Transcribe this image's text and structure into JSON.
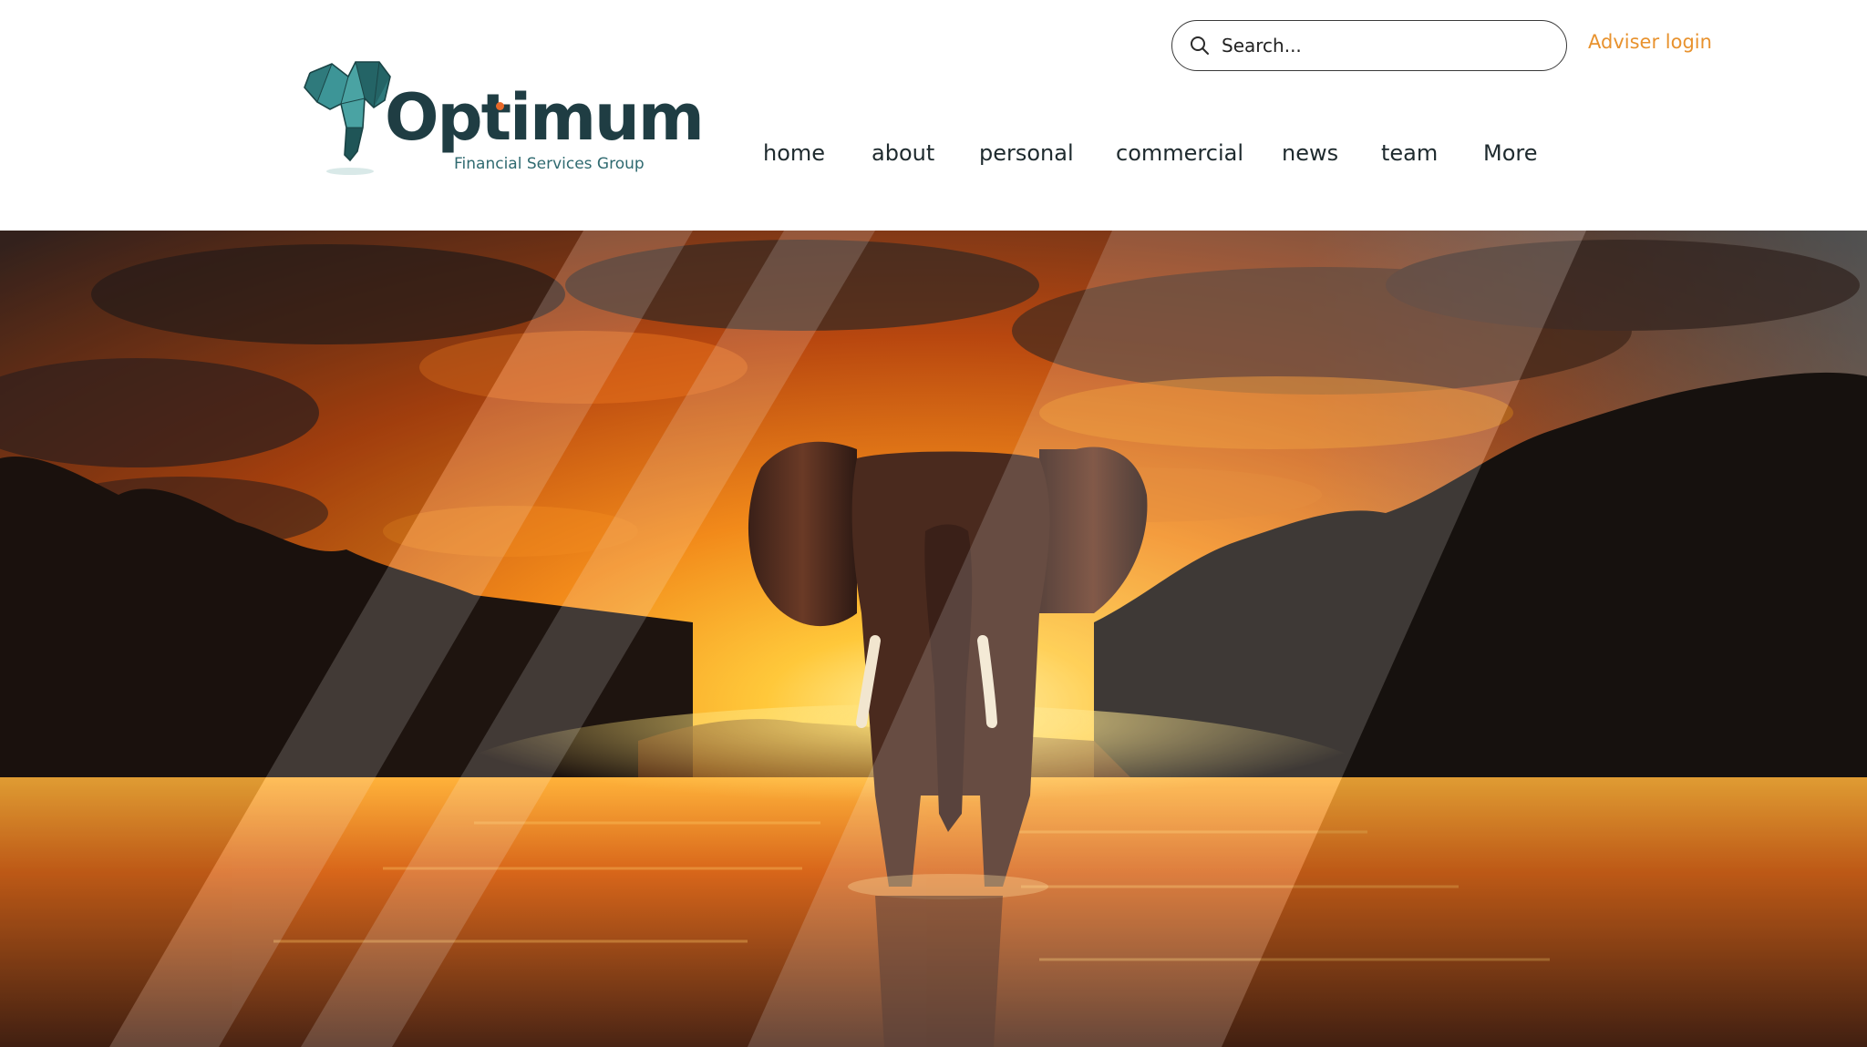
{
  "header": {
    "logo": {
      "word": "Optimum",
      "tagline": "Financial Services Group",
      "mark_icon": "elephant-head-logo-icon",
      "colors": {
        "teal": "#2f7a7c",
        "dark": "#1f3d43",
        "accent": "#e8692a"
      }
    },
    "search": {
      "placeholder": "Search...",
      "icon": "search-icon"
    },
    "adviser_login": "Adviser login",
    "nav": [
      {
        "label": "home"
      },
      {
        "label": "about"
      },
      {
        "label": "personal"
      },
      {
        "label": "commercial"
      },
      {
        "label": "news"
      },
      {
        "label": "team"
      },
      {
        "label": "More"
      }
    ]
  },
  "hero": {
    "image": "elephant-sunset-river-image",
    "colors": {
      "sky_top": "#3a2a22",
      "sun": "#ffd24a",
      "glow": "#f08a1c",
      "water": "#c85a14",
      "dark": "#1a1410"
    }
  },
  "theme": {
    "accent": "#e8922e",
    "text": "#1e2a2e"
  }
}
